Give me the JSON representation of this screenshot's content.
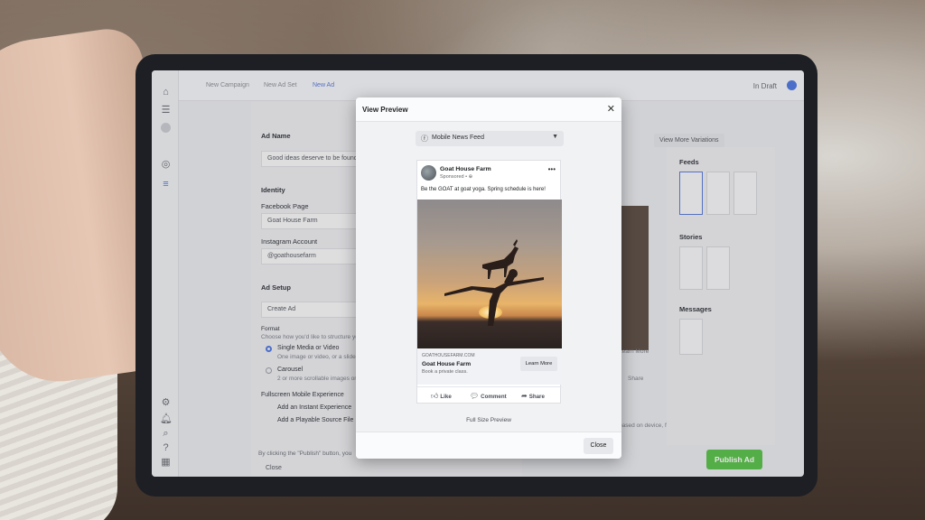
{
  "topbar": {
    "crumbs": [
      "New Campaign",
      "New Ad Set",
      "New Ad"
    ],
    "status": "In Draft"
  },
  "form": {
    "ad_name_label": "Ad Name",
    "ad_name_value": "Good ideas deserve to be found.",
    "identity_label": "Identity",
    "facebook_page_label": "Facebook Page",
    "facebook_page_value": "Goat House Farm",
    "instagram_label": "Instagram Account",
    "instagram_value": "@goathousefarm",
    "ad_setup_label": "Ad Setup",
    "create_ad_value": "Create Ad",
    "format_label": "Format",
    "format_help": "Choose how you'd like to structure your ad.",
    "option_single": "Single Media or Video",
    "option_single_help": "One image or video, or a slideshow",
    "option_carousel": "Carousel",
    "option_carousel_help": "2 or more scrollable images or videos",
    "fullscreen_label": "Fullscreen Mobile Experience",
    "add_instant": "Add an Instant Experience",
    "add_playable": "Add a Playable Source File",
    "footer_text": "By clicking the \"Publish\" button, you",
    "footer_close": "Close"
  },
  "right": {
    "view_more": "View More Variations",
    "feeds": "Feeds",
    "stories": "Stories",
    "messages": "Messages",
    "learn_more_partial": "Learn More",
    "share_partial": "Share",
    "disclaimer": "based on device, format, and other factors."
  },
  "publish_label": "Publish Ad",
  "modal": {
    "title": "View Preview",
    "placement": "Mobile News Feed",
    "post": {
      "page_name": "Goat House Farm",
      "sponsored": "Sponsored •",
      "caption": "Be the GOAT at goat yoga. Spring schedule is here!",
      "domain": "GOATHOUSEFARM.COM",
      "headline": "Goat House Farm",
      "description": "Book a private class.",
      "cta": "Learn More",
      "like": "Like",
      "comment": "Comment",
      "share": "Share"
    },
    "full_size": "Full Size Preview",
    "close": "Close"
  },
  "icons": [
    "home-icon",
    "grid-icon",
    "globe-icon",
    "list-icon",
    "settings-icon",
    "bell-icon",
    "search-icon",
    "help-icon",
    "report-icon",
    "close-icon",
    "chevron-down-icon",
    "more-icon",
    "like-icon",
    "comment-icon",
    "share-icon"
  ]
}
